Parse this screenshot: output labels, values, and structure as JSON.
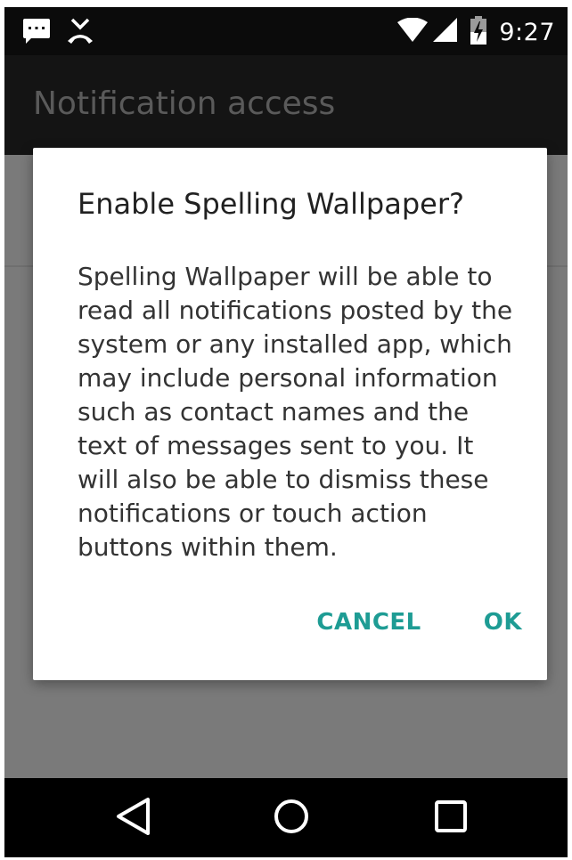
{
  "status_bar": {
    "time": "9:27",
    "left_icons": [
      "message-notification-icon",
      "missed-call-icon"
    ],
    "right_icons": [
      "wifi-icon",
      "cell-signal-icon",
      "battery-charging-icon"
    ]
  },
  "action_bar": {
    "title": "Notification access"
  },
  "dialog": {
    "title": "Enable Spelling Wallpaper?",
    "message": "Spelling Wallpaper will be able to read all notifications posted by the system or any installed app, which may include personal information such as contact names and the text of messages sent to you. It will also be able to dismiss these notifications or touch action buttons within them.",
    "cancel_label": "CANCEL",
    "ok_label": "OK"
  },
  "nav_bar": {
    "icons": [
      "back-icon",
      "home-icon",
      "recents-icon"
    ]
  },
  "colors": {
    "accent": "#1e9c94",
    "scrim": "#7a7a7a",
    "bar": "#0b0b0b"
  }
}
